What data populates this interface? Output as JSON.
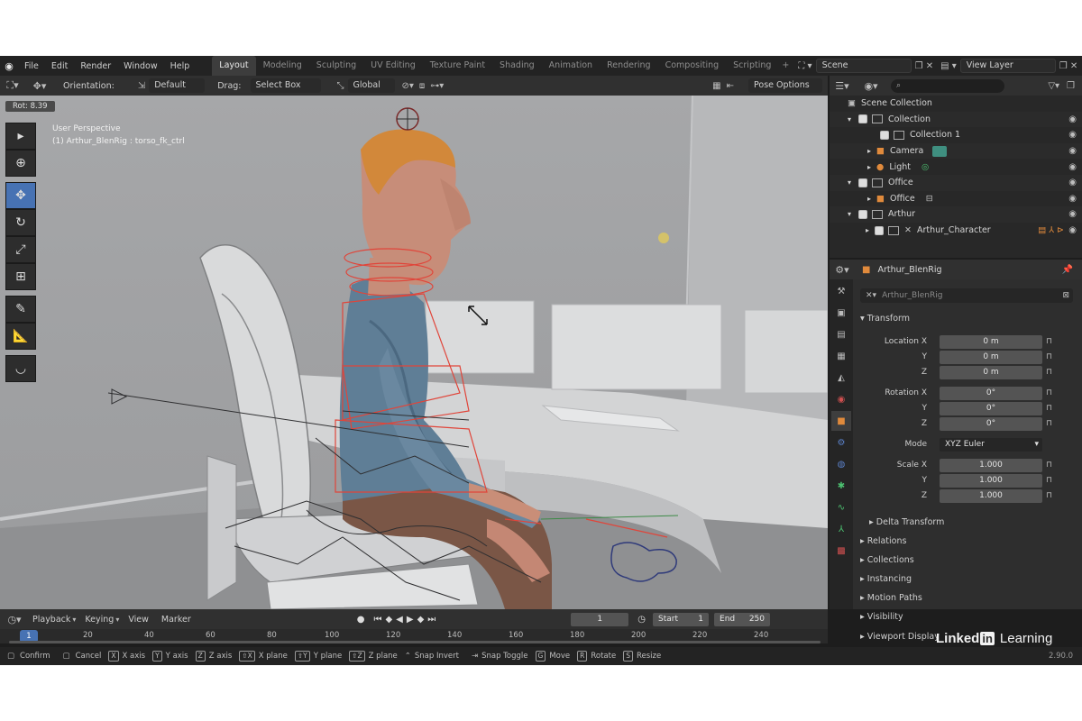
{
  "topbar": {
    "menus": [
      "File",
      "Edit",
      "Render",
      "Window",
      "Help"
    ],
    "workspaces": [
      "Layout",
      "Modeling",
      "Sculpting",
      "UV Editing",
      "Texture Paint",
      "Shading",
      "Animation",
      "Rendering",
      "Compositing",
      "Scripting"
    ],
    "add_tab": "+",
    "scene": "Scene",
    "view_layer": "View Layer"
  },
  "viewport_header": {
    "orientation_label": "Orientation:",
    "orientation_value": "Default",
    "drag_label": "Drag:",
    "drag_value": "Select Box",
    "transform_space": "Global",
    "pose_options": "Pose Options"
  },
  "viewport": {
    "rot_readout": "Rot: 8.39",
    "perspective": "User Perspective",
    "object_info": "(1) Arthur_BlenRig : torso_fk_ctrl"
  },
  "outliner": {
    "rows": [
      {
        "label": "Scene Collection",
        "indent": 0
      },
      {
        "label": "Collection",
        "indent": 1
      },
      {
        "label": "Collection 1",
        "indent": 2
      },
      {
        "label": "Camera",
        "indent": 2
      },
      {
        "label": "Light",
        "indent": 2
      },
      {
        "label": "Office",
        "indent": 1
      },
      {
        "label": "Office",
        "indent": 2
      },
      {
        "label": "Arthur",
        "indent": 1
      },
      {
        "label": "Arthur_Character",
        "indent": 2
      }
    ]
  },
  "properties": {
    "object_name": "Arthur_BlenRig",
    "data_name": "Arthur_BlenRig",
    "transform_header": "Transform",
    "location_label": "Location X",
    "rotation_label": "Rotation X",
    "scale_label": "Scale X",
    "axis_y": "Y",
    "axis_z": "Z",
    "location": [
      "0 m",
      "0 m",
      "0 m"
    ],
    "rotation": [
      "0°",
      "0°",
      "0°"
    ],
    "mode_label": "Mode",
    "mode_value": "XYZ Euler",
    "scale": [
      "1.000",
      "1.000",
      "1.000"
    ],
    "delta_transform": "Delta Transform",
    "panels": [
      "Relations",
      "Collections",
      "Instancing",
      "Motion Paths",
      "Visibility",
      "Viewport Display"
    ]
  },
  "timeline": {
    "menus": [
      "Playback",
      "Keying",
      "View",
      "Marker"
    ],
    "current_frame": "1",
    "start_label": "Start",
    "start_value": "1",
    "end_label": "End",
    "end_value": "250",
    "ruler_ticks": [
      "1",
      "20",
      "40",
      "60",
      "80",
      "100",
      "120",
      "140",
      "160",
      "180",
      "200",
      "220",
      "240"
    ]
  },
  "statusbar": {
    "items": [
      {
        "key": "",
        "label": "Confirm"
      },
      {
        "key": "",
        "label": "Cancel"
      },
      {
        "key": "X",
        "label": "X axis"
      },
      {
        "key": "Y",
        "label": "Y axis"
      },
      {
        "key": "Z",
        "label": "Z axis"
      },
      {
        "key": "⇧X",
        "label": "X plane"
      },
      {
        "key": "⇧Y",
        "label": "Y plane"
      },
      {
        "key": "⇧Z",
        "label": "Z plane"
      },
      {
        "key": "",
        "label": "Snap Invert"
      },
      {
        "key": "",
        "label": "Snap Toggle"
      },
      {
        "key": "G",
        "label": "Move"
      },
      {
        "key": "R",
        "label": "Rotate"
      },
      {
        "key": "S",
        "label": "Resize"
      }
    ],
    "version": "2.90.0"
  },
  "watermark": {
    "text1": "Linked",
    "text2": "in",
    "text3": "Learning"
  },
  "colors": {
    "accent": "#4772b3",
    "viewport_bg": "#9c9d9f",
    "bone_red": "#e0453a",
    "panel_bg": "#2e2e2e"
  }
}
